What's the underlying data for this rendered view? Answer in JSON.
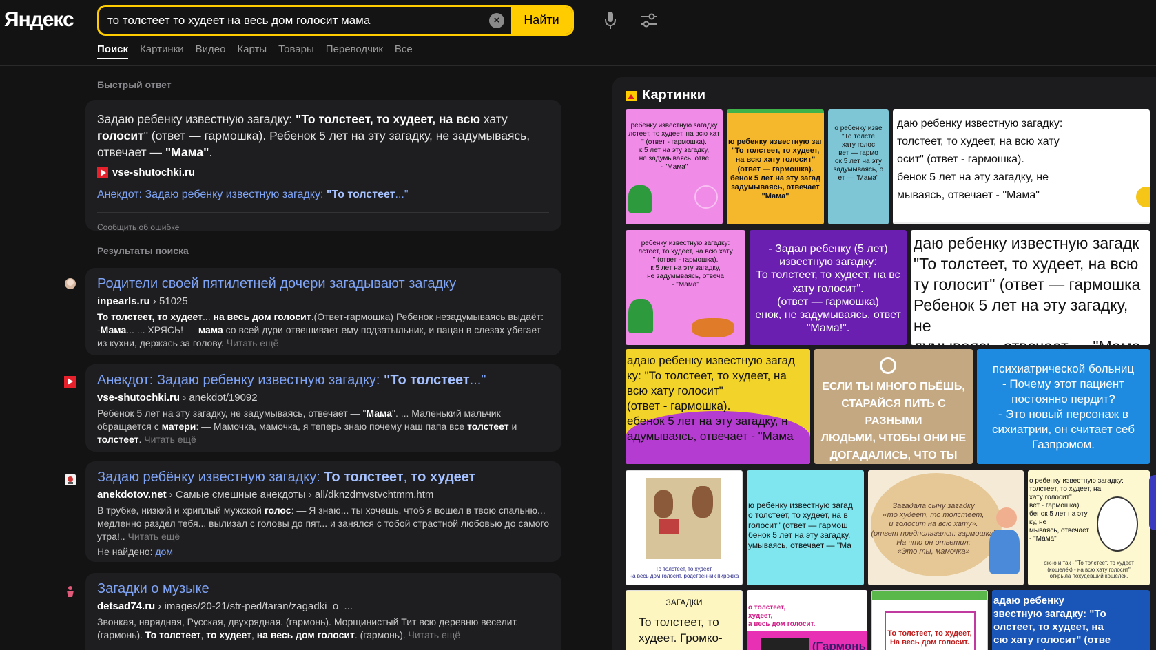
{
  "logo": "Яндекс",
  "search": {
    "value": "то толстеет то худеет на весь дом голосит мама",
    "button": "Найти"
  },
  "tabs": [
    "Поиск",
    "Картинки",
    "Видео",
    "Карты",
    "Товары",
    "Переводчик",
    "Все"
  ],
  "quick_answer": {
    "section_title": "Быстрый ответ",
    "site": "vse-shutochki.ru",
    "report": "Сообщить об ошибке"
  },
  "results_title": "Результаты поиска",
  "results": [
    {
      "url_domain": "inpearls.ru",
      "url_path": " › 51025"
    },
    {
      "url_domain": "vse-shutochki.ru",
      "url_path": " › anekdot/19092"
    },
    {
      "url_domain": "anekdotov.net",
      "url_path": " › Самые смешные анекдоты › all/dknzdmvstvchtmm.htm",
      "notfound_label": "Не найдено: ",
      "notfound_link": "дом"
    },
    {
      "title": "Загадки о музыке",
      "url_domain": "detsad74.ru",
      "url_path": " › images/20-21/str-ped/taran/zagadki_o_..."
    }
  ],
  "more_label": "Читать ещё",
  "images": {
    "title": "Картинки"
  },
  "colors": {
    "accent": "#ffcc00",
    "link": "#7fa3f5",
    "bg": "#131314",
    "card": "#1e1e20"
  },
  "icons": [
    "mic-icon",
    "filter-icon",
    "clear-icon",
    "images-icon"
  ]
}
